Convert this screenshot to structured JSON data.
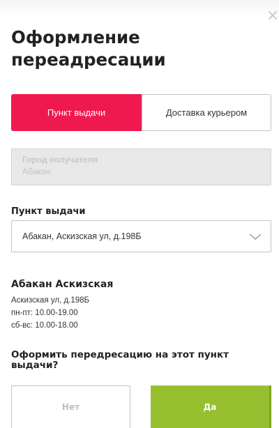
{
  "modal": {
    "title_line1": "Оформление",
    "title_line2": "переадресации",
    "close_icon": "×"
  },
  "tabs": {
    "pickup_label": "Пункт выдачи",
    "courier_label": "Доставка курьером",
    "active": "pickup"
  },
  "city": {
    "label": "Город получателя",
    "value": "Абакан"
  },
  "pickup_select": {
    "label": "Пункт выдачи",
    "value": "Абакан, Аскизская ул, д.198Б",
    "icon": "chevron-down-icon"
  },
  "point": {
    "name": "Абакан Аскизская",
    "address": "Аскизская ул, д.198Б",
    "hours_weekdays": "пн-пт: 10.00-19.00",
    "hours_weekend": "сб-вс: 10.00-18.00"
  },
  "confirm": {
    "question": "Оформить передресацию на этот пункт выдачи?",
    "no_label": "Нет",
    "yes_label": "Да"
  },
  "colors": {
    "accent_pink": "#f0194f",
    "accent_green": "#97c030",
    "border": "#b9c6cf"
  }
}
